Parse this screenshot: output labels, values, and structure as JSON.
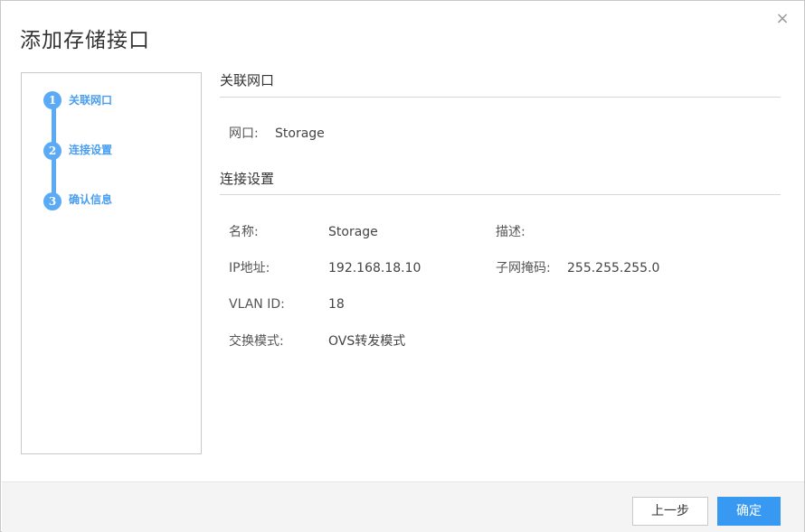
{
  "dialog": {
    "title": "添加存储接口",
    "close_symbol": "×"
  },
  "steps": [
    {
      "num": "1",
      "label": "关联网口"
    },
    {
      "num": "2",
      "label": "连接设置"
    },
    {
      "num": "3",
      "label": "确认信息"
    }
  ],
  "section_port": {
    "title": "关联网口",
    "port_label": "网口:",
    "port_value": "Storage"
  },
  "section_conn": {
    "title": "连接设置",
    "name_label": "名称:",
    "name_value": "Storage",
    "desc_label": "描述:",
    "desc_value": "",
    "ip_label": "IP地址:",
    "ip_value": "192.168.18.10",
    "mask_label": "子网掩码:",
    "mask_value": "255.255.255.0",
    "vlan_label": "VLAN ID:",
    "vlan_value": "18",
    "mode_label": "交换模式:",
    "mode_value": "OVS转发模式"
  },
  "footer": {
    "prev_label": "上一步",
    "ok_label": "确定"
  },
  "colors": {
    "accent": "#3799f2",
    "step": "#5aaaf5"
  }
}
